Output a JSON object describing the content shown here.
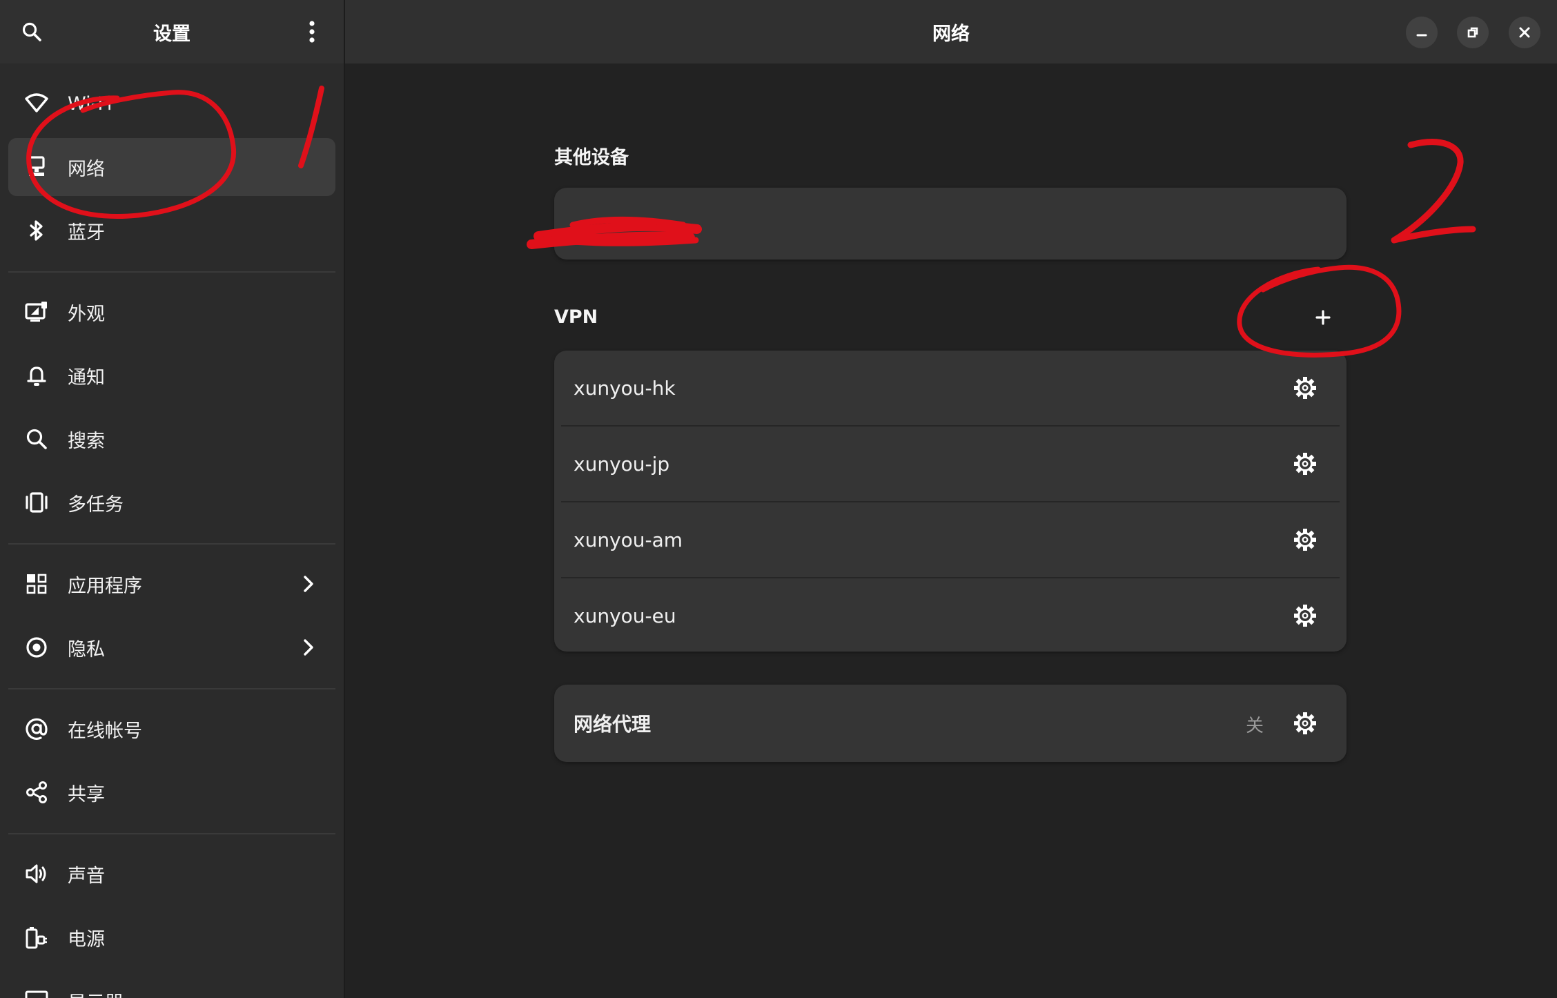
{
  "sidebar": {
    "title": "设置",
    "search_icon": "search-icon",
    "menu_icon": "kebab-menu-icon",
    "items": [
      {
        "label": "Wi-Fi",
        "icon": "wifi-icon"
      },
      {
        "label": "网络",
        "icon": "network-wired-icon",
        "selected": true
      },
      {
        "label": "蓝牙",
        "icon": "bluetooth-icon"
      },
      {
        "label": "外观",
        "icon": "appearance-icon"
      },
      {
        "label": "通知",
        "icon": "bell-icon"
      },
      {
        "label": "搜索",
        "icon": "search-icon"
      },
      {
        "label": "多任务",
        "icon": "multitasking-icon"
      },
      {
        "label": "应用程序",
        "icon": "apps-grid-icon",
        "has_submenu": true
      },
      {
        "label": "隐私",
        "icon": "privacy-icon",
        "has_submenu": true
      },
      {
        "label": "在线帐号",
        "icon": "at-sign-icon"
      },
      {
        "label": "共享",
        "icon": "share-icon"
      },
      {
        "label": "声音",
        "icon": "speaker-icon"
      },
      {
        "label": "电源",
        "icon": "power-icon"
      },
      {
        "label": "显示器",
        "icon": "display-icon"
      }
    ]
  },
  "main": {
    "title": "网络",
    "window_controls": [
      "minimize-icon",
      "restore-icon",
      "close-icon"
    ],
    "other_devices": {
      "title": "其他设备",
      "device": {
        "label": "",
        "enabled": false
      }
    },
    "vpn": {
      "title": "VPN",
      "add_icon": "plus-icon",
      "connections": [
        {
          "name": "xunyou-hk",
          "enabled": false
        },
        {
          "name": "xunyou-jp",
          "enabled": false
        },
        {
          "name": "xunyou-am",
          "enabled": false
        },
        {
          "name": "xunyou-eu",
          "enabled": false
        }
      ]
    },
    "proxy": {
      "label": "网络代理",
      "status": "关"
    }
  },
  "annotations": {
    "color": "#e0101a",
    "marks": [
      "1",
      "2"
    ]
  },
  "colors": {
    "sidebar_bg": "#2b2b2b",
    "main_bg": "#222222",
    "card_bg": "#353535",
    "selected_bg": "#3d3d3d",
    "header_bg": "#303030"
  }
}
